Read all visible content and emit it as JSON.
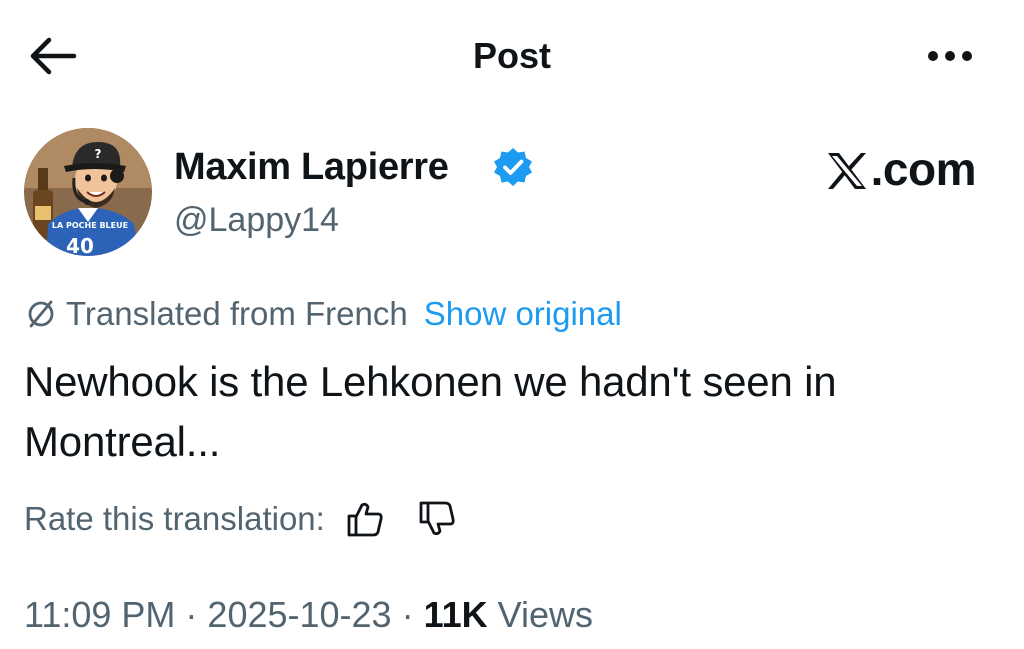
{
  "header": {
    "title": "Post",
    "back_icon": "arrow-left-icon",
    "more_icon": "more-horizontal-icon"
  },
  "author": {
    "name": "Maxim Lapierre",
    "handle": "@Lappy14",
    "verified": true,
    "avatar_jersey_text": "LA POCHE BLEUE",
    "avatar_jersey_number": "40"
  },
  "watermark": {
    "text": ".com",
    "logo_icon": "x-logo-icon"
  },
  "translation": {
    "label": "Translated from French",
    "show_original_label": "Show original"
  },
  "tweet": {
    "text": "Newhook is the Lehkonen we hadn't seen in Montreal..."
  },
  "rating": {
    "label": "Rate this translation:"
  },
  "meta": {
    "time": "11:09 PM",
    "date": "2025-10-23",
    "separator": "·",
    "views_count": "11K",
    "views_label": "Views"
  },
  "colors": {
    "text_primary": "#0f1419",
    "text_secondary": "#536471",
    "accent": "#1d9bf0"
  }
}
